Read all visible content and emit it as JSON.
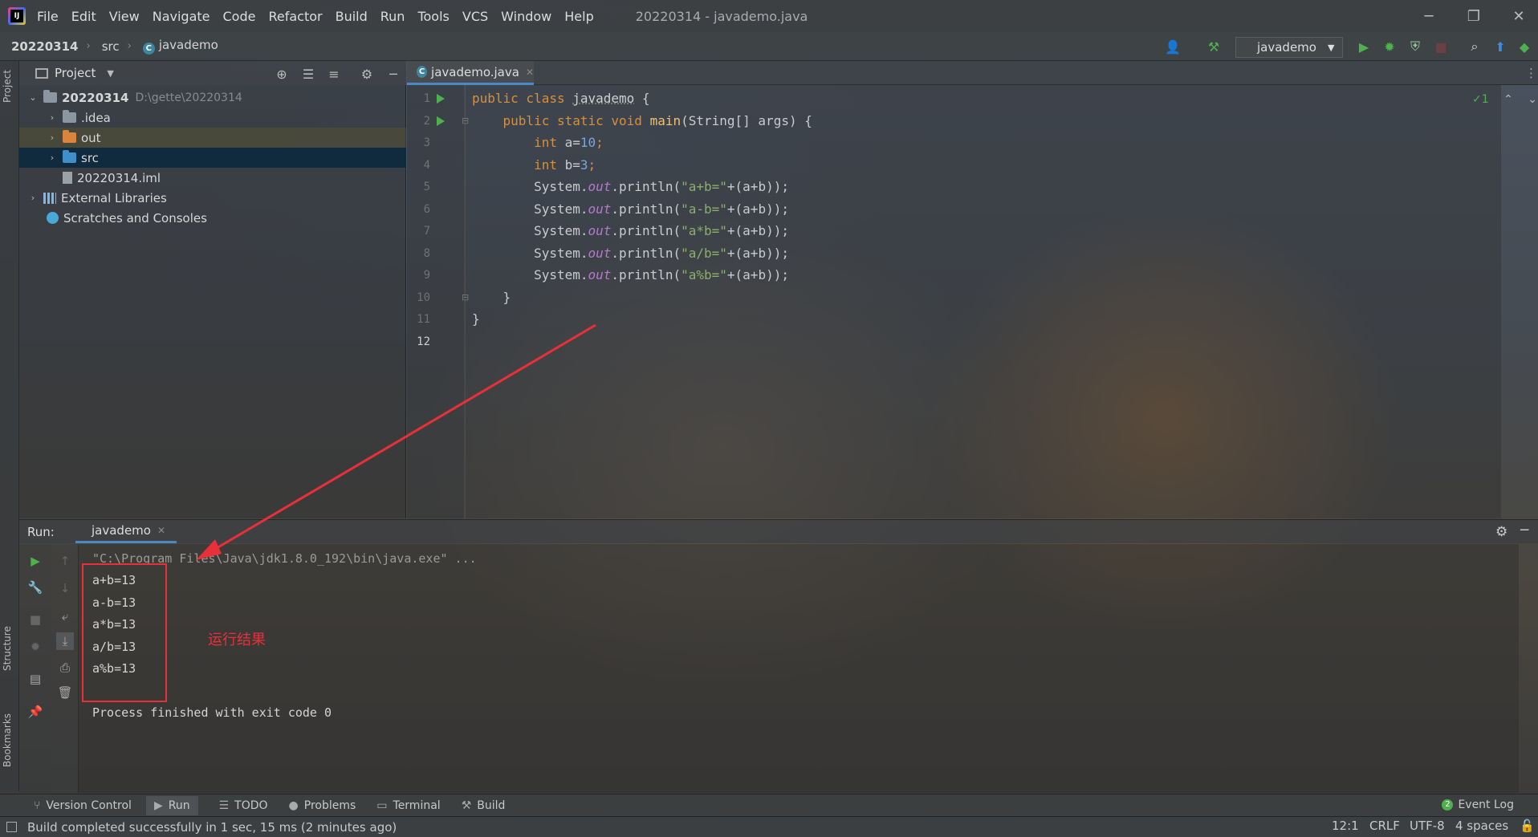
{
  "window": {
    "title": "20220314 - javademo.java",
    "menu": [
      "File",
      "Edit",
      "View",
      "Navigate",
      "Code",
      "Refactor",
      "Build",
      "Run",
      "Tools",
      "VCS",
      "Window",
      "Help"
    ],
    "controls": {
      "minimize": "─",
      "restore": "❐",
      "close": "✕"
    }
  },
  "navbar": {
    "crumbs": [
      "20220314",
      "src",
      "javademo"
    ],
    "run_config": "javademo"
  },
  "project": {
    "header": "Project",
    "tree": [
      {
        "label": "20220314",
        "path": "D:\\gette\\20220314",
        "arrow": "⌄"
      },
      {
        "label": ".idea",
        "arrow": "›"
      },
      {
        "label": "out",
        "arrow": "›"
      },
      {
        "label": "src",
        "arrow": "›"
      },
      {
        "label": "20220314.iml",
        "arrow": ""
      },
      {
        "label": "External Libraries",
        "arrow": "›"
      },
      {
        "label": "Scratches and Consoles",
        "arrow": ""
      }
    ]
  },
  "editor": {
    "tab": "javademo.java",
    "inspection": "✓1",
    "line_numbers": [
      "1",
      "2",
      "3",
      "4",
      "5",
      "6",
      "7",
      "8",
      "9",
      "10",
      "11",
      "12"
    ],
    "code": {
      "l1": {
        "kw": "public class ",
        "cls": "javademo",
        "rest": " {"
      },
      "l2": {
        "indent": "    ",
        "kw": "public static void ",
        "fn": "main",
        "rest": "(String[] args) {"
      },
      "l3": {
        "indent": "        ",
        "kw": "int ",
        "var": "a=",
        "num": "10",
        "end": ";"
      },
      "l4": {
        "indent": "        ",
        "kw": "int ",
        "var": "b=",
        "num": "3",
        "end": ";"
      },
      "l5": {
        "pre": "        System.",
        "fld": "out",
        "mid": ".println(",
        "str": "\"a+b=\"",
        "end": "+(a+b));"
      },
      "l6": {
        "pre": "        System.",
        "fld": "out",
        "mid": ".println(",
        "str": "\"a-b=\"",
        "end": "+(a+b));"
      },
      "l7": {
        "pre": "        System.",
        "fld": "out",
        "mid": ".println(",
        "str": "\"a*b=\"",
        "end": "+(a+b));"
      },
      "l8": {
        "pre": "        System.",
        "fld": "out",
        "mid": ".println(",
        "str": "\"a/b=\"",
        "end": "+(a+b));"
      },
      "l9": {
        "pre": "        System.",
        "fld": "out",
        "mid": ".println(",
        "str": "\"a%b=\"",
        "end": "+(a+b));"
      },
      "l10": "    }",
      "l11": "}"
    }
  },
  "run": {
    "label": "Run:",
    "tab": "javademo",
    "console": [
      "\"C:\\Program Files\\Java\\jdk1.8.0_192\\bin\\java.exe\" ...",
      "a+b=13",
      "a-b=13",
      "a*b=13",
      "a/b=13",
      "a%b=13",
      "",
      "Process finished with exit code 0"
    ],
    "annotation": "运行结果"
  },
  "side_labels": {
    "project": "Project",
    "structure": "Structure",
    "bookmarks": "Bookmarks"
  },
  "toolwindows": [
    "Version Control",
    "Run",
    "TODO",
    "Problems",
    "Terminal",
    "Build"
  ],
  "event_log": {
    "count": "2",
    "label": "Event Log"
  },
  "status": {
    "message": "Build completed successfully in 1 sec, 15 ms (2 minutes ago)",
    "position": "12:1",
    "line_sep": "CRLF",
    "encoding": "UTF-8",
    "indent": "4 spaces"
  },
  "colors": {
    "accent": "#4a88c7",
    "annotation": "#e8303a",
    "run_green": "#4eb14e"
  }
}
